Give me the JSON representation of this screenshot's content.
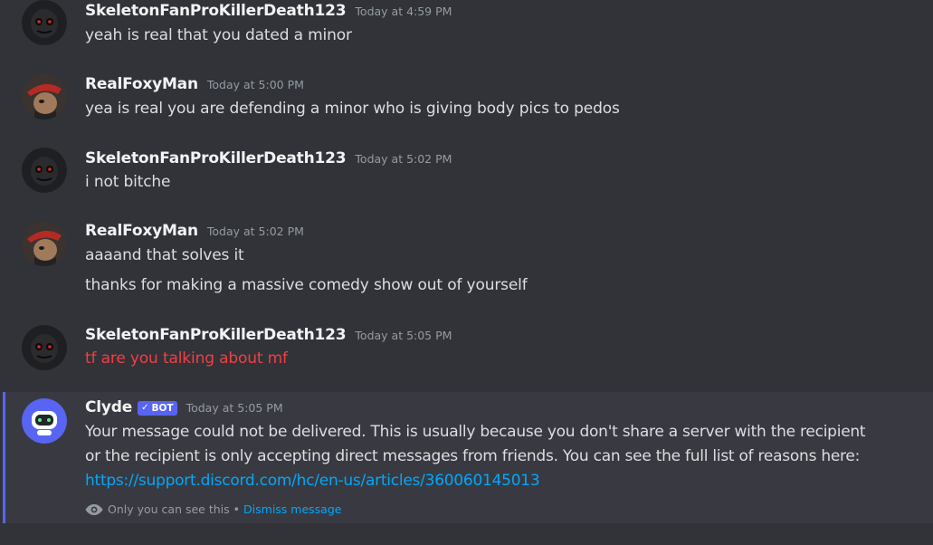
{
  "messages": [
    {
      "username": "SkeletonFanProKillerDeath123",
      "timestamp": "Today at 4:59 PM",
      "lines": [
        "yeah is real that you dated a minor"
      ]
    },
    {
      "username": "RealFoxyMan",
      "timestamp": "Today at 5:00 PM",
      "lines": [
        "yea is real you are defending a minor who is giving body pics to pedos"
      ]
    },
    {
      "username": "SkeletonFanProKillerDeath123",
      "timestamp": "Today at 5:02 PM",
      "lines": [
        "i not bitche"
      ]
    },
    {
      "username": "RealFoxyMan",
      "timestamp": "Today at 5:02 PM",
      "lines": [
        "aaaand that solves it",
        "thanks for making a massive comedy show out of yourself"
      ]
    },
    {
      "username": "SkeletonFanProKillerDeath123",
      "timestamp": "Today at 5:05 PM",
      "lines": [
        "tf are you talking about mf"
      ],
      "failed": true
    }
  ],
  "clyde": {
    "username": "Clyde",
    "bot_tag": "BOT",
    "timestamp": "Today at 5:05 PM",
    "lines": [
      "Your message could not be delivered. This is usually because you don't share a server with the recipient",
      "or the recipient is only accepting direct messages from friends. You can see the full list of reasons here:"
    ],
    "link": "https://support.discord.com/hc/en-us/articles/360060145013",
    "only_you": "Only you can see this",
    "separator": "•",
    "dismiss": "Dismiss message"
  },
  "colors": {
    "background": "#313338",
    "failed_text": "#f23f43",
    "link": "#00a8fc",
    "blurple": "#5865f2"
  },
  "icons": {
    "bot_check": "checkmark-icon",
    "ephemeral": "eye-icon"
  }
}
